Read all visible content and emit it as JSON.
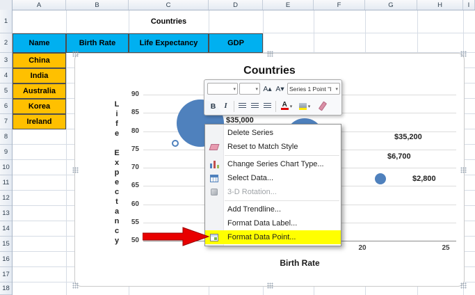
{
  "spreadsheet": {
    "column_headers": [
      "A",
      "B",
      "C",
      "D",
      "E",
      "F",
      "G",
      "H",
      "I"
    ],
    "row_numbers": [
      "1",
      "2",
      "3",
      "4",
      "5",
      "6",
      "7",
      "8",
      "9",
      "10",
      "11",
      "12",
      "13",
      "14",
      "15",
      "16",
      "17",
      "18"
    ],
    "cells": {
      "title": "Countries",
      "headers": [
        "Name",
        "Birth Rate",
        "Life Expectancy",
        "GDP"
      ],
      "names": [
        "China",
        "India",
        "Australia",
        "Korea",
        "Ireland"
      ]
    },
    "colors": {
      "header_fill": "#00B0F0",
      "names_fill": "#FFC000"
    }
  },
  "chart": {
    "title": "Countries",
    "y_axis_title": "Life Expectancy",
    "x_axis_title": "Birth Rate",
    "y_ticks": [
      "90",
      "85",
      "80",
      "75",
      "70",
      "65",
      "60",
      "55",
      "50"
    ],
    "x_ticks": [
      "20",
      "25"
    ],
    "bubble_labels": [
      "$35,000",
      "$35,200",
      "$6,700",
      "$2,800"
    ],
    "bubble_color": "#4F81BD"
  },
  "chart_data": {
    "type": "bubble",
    "title": "Countries",
    "xlabel": "Birth Rate",
    "ylabel": "Life Expectancy",
    "ylim": [
      50,
      90
    ],
    "y_axis_ticks": [
      90,
      85,
      80,
      75,
      70,
      65,
      60,
      55,
      50
    ],
    "x_axis_visible_ticks": [
      20,
      25
    ],
    "grid": "horizontal gridlines on",
    "series": [
      {
        "name": "Series 1",
        "points": [
          {
            "x": 10,
            "y": 82,
            "size_label": "$35,000"
          },
          {
            "x": 16.5,
            "y": 80,
            "size_label": "$35,200"
          },
          {
            "x": 19,
            "y": 73,
            "size_label": "$6,700"
          },
          {
            "x": 21,
            "y": 67,
            "size_label": "$2,800"
          },
          {
            "x": 8.8,
            "y": 76.5,
            "size_label": ""
          }
        ]
      }
    ]
  },
  "mini_toolbar": {
    "chart_element": "Series 1 Point \"I",
    "bold": "B",
    "italic": "I",
    "grow_font": "A▴",
    "shrink_font": "A▾"
  },
  "context_menu": {
    "items": [
      {
        "label": "Delete Series"
      },
      {
        "label": "Reset to Match Style"
      },
      {
        "label": "Change Series Chart Type..."
      },
      {
        "label": "Select Data..."
      },
      {
        "label": "3-D Rotation...",
        "disabled": true
      },
      {
        "label": "Add Trendline..."
      },
      {
        "label": "Format Data Label..."
      },
      {
        "label": "Format Data Point...",
        "highlighted": true
      }
    ]
  }
}
